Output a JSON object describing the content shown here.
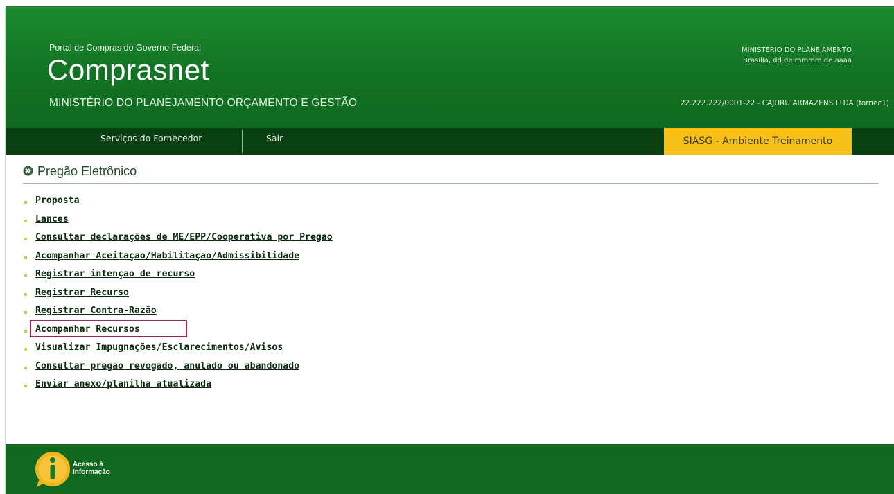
{
  "header": {
    "portal_subtitle": "Portal de Compras do Governo Federal",
    "site_title": "Comprasnet",
    "ministry": "MINISTÉRIO DO PLANEJAMENTO ORÇAMENTO E GESTÃO",
    "top_right_ministry": "MINISTÉRIO DO PLANEJAMENTO",
    "top_right_date": "Brasília, dd de mmmm de aaaa",
    "user_info": "22.222.222/0001-22 - CAJURU ARMAZENS LTDA (fornec1)"
  },
  "nav": {
    "items": [
      "Serviços do Fornecedor",
      "Sair"
    ],
    "environment_label": "SIASG - Ambiente Treinamento"
  },
  "section": {
    "title": "Pregão Eletrônico"
  },
  "menu": {
    "items": [
      "Proposta",
      "Lances",
      "Consultar declarações de ME/EPP/Cooperativa por Pregão",
      "Acompanhar Aceitação/Habilitação/Admissibilidade",
      "Registrar intenção de recurso",
      "Registrar Recurso",
      "Registrar Contra-Razão",
      "Acompanhar Recursos",
      "Visualizar Impugnações/Esclarecimentos/Avisos",
      "Consultar pregão revogado, anulado ou abandonado",
      "Enviar anexo/planilha atualizada"
    ],
    "highlighted_item": "Acompanhar Recursos"
  },
  "footer": {
    "logo_line1": "Acesso à",
    "logo_line2": "Informação"
  },
  "colors": {
    "header_green": "#137324",
    "nav_dark_green": "#0a3f12",
    "environment_yellow": "#f6c018",
    "highlight_border": "#9a2456",
    "bullet": "#c4d24b"
  },
  "icons": {
    "section": "double-chevron-right-icon",
    "footer_logo": "info-icon",
    "bullet": "square-bullet-icon"
  }
}
